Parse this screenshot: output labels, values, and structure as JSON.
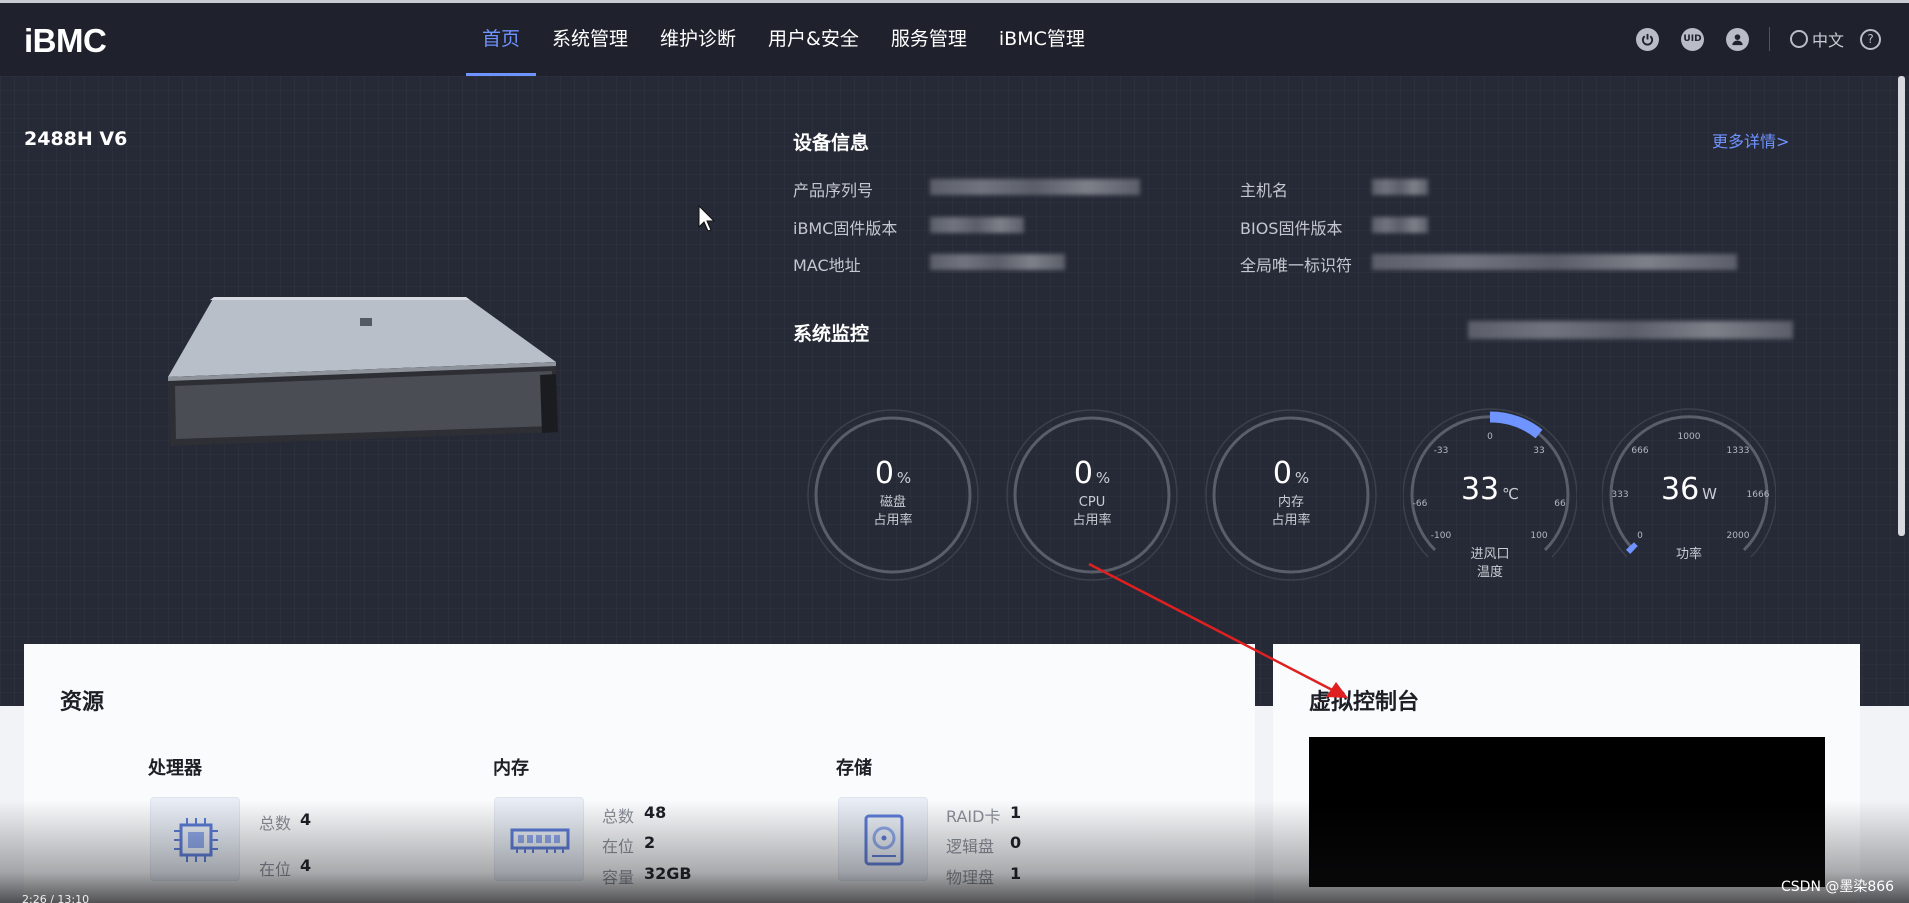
{
  "app": {
    "logo": "iBMC"
  },
  "nav": {
    "items": [
      "首页",
      "系统管理",
      "维护诊断",
      "用户&安全",
      "服务管理",
      "iBMC管理"
    ],
    "active_index": 0
  },
  "topbar": {
    "icons": [
      "power-icon",
      "uid-icon",
      "user-icon",
      "globe-icon",
      "help-icon"
    ],
    "uid_label": "UID",
    "language": "中文",
    "help_glyph": "?"
  },
  "device": {
    "model": "2488H V6"
  },
  "device_info": {
    "title": "设备信息",
    "more": "更多详情>",
    "labels": {
      "serial": "产品序列号",
      "ibmc_fw": "iBMC固件版本",
      "mac": "MAC地址",
      "hostname": "主机名",
      "bios_fw": "BIOS固件版本",
      "uuid": "全局唯一标识符"
    }
  },
  "monitor": {
    "title": "系统监控",
    "gauges": {
      "disk": {
        "value": "0",
        "unit": "%",
        "label1": "磁盘",
        "label2": "占用率"
      },
      "cpu": {
        "value": "0",
        "unit": "%",
        "label1": "CPU",
        "label2": "占用率"
      },
      "mem": {
        "value": "0",
        "unit": "%",
        "label1": "内存",
        "label2": "占用率"
      },
      "temp": {
        "value": "33",
        "unit": "℃",
        "label1": "进风口",
        "label2": "温度",
        "ticks": [
          "-100",
          "-66",
          "-33",
          "0",
          "33",
          "66",
          "100"
        ]
      },
      "power": {
        "value": "36",
        "unit": "W",
        "label1": "功率",
        "ticks": [
          "0",
          "333",
          "666",
          "1000",
          "1333",
          "1666",
          "2000"
        ]
      }
    }
  },
  "resources": {
    "title": "资源",
    "cpu": {
      "title": "处理器",
      "k1": "总数",
      "v1": "4",
      "k2": "在位",
      "v2": "4"
    },
    "memory": {
      "title": "内存",
      "k1": "总数",
      "v1": "48",
      "k2": "在位",
      "v2": "2",
      "k3": "容量",
      "v3": "32GB"
    },
    "storage": {
      "title": "存储",
      "k1": "RAID卡",
      "v1": "1",
      "k2": "逻辑盘",
      "v2": "0",
      "k3": "物理盘",
      "v3": "1"
    }
  },
  "virtual_console": {
    "title": "虚拟控制台"
  },
  "watermark": "CSDN @墨染866",
  "player": {
    "time": "2:26 / 13:10"
  },
  "colors": {
    "accent": "#6f93ff",
    "background": "#262a36",
    "card": "#fafbfd"
  }
}
